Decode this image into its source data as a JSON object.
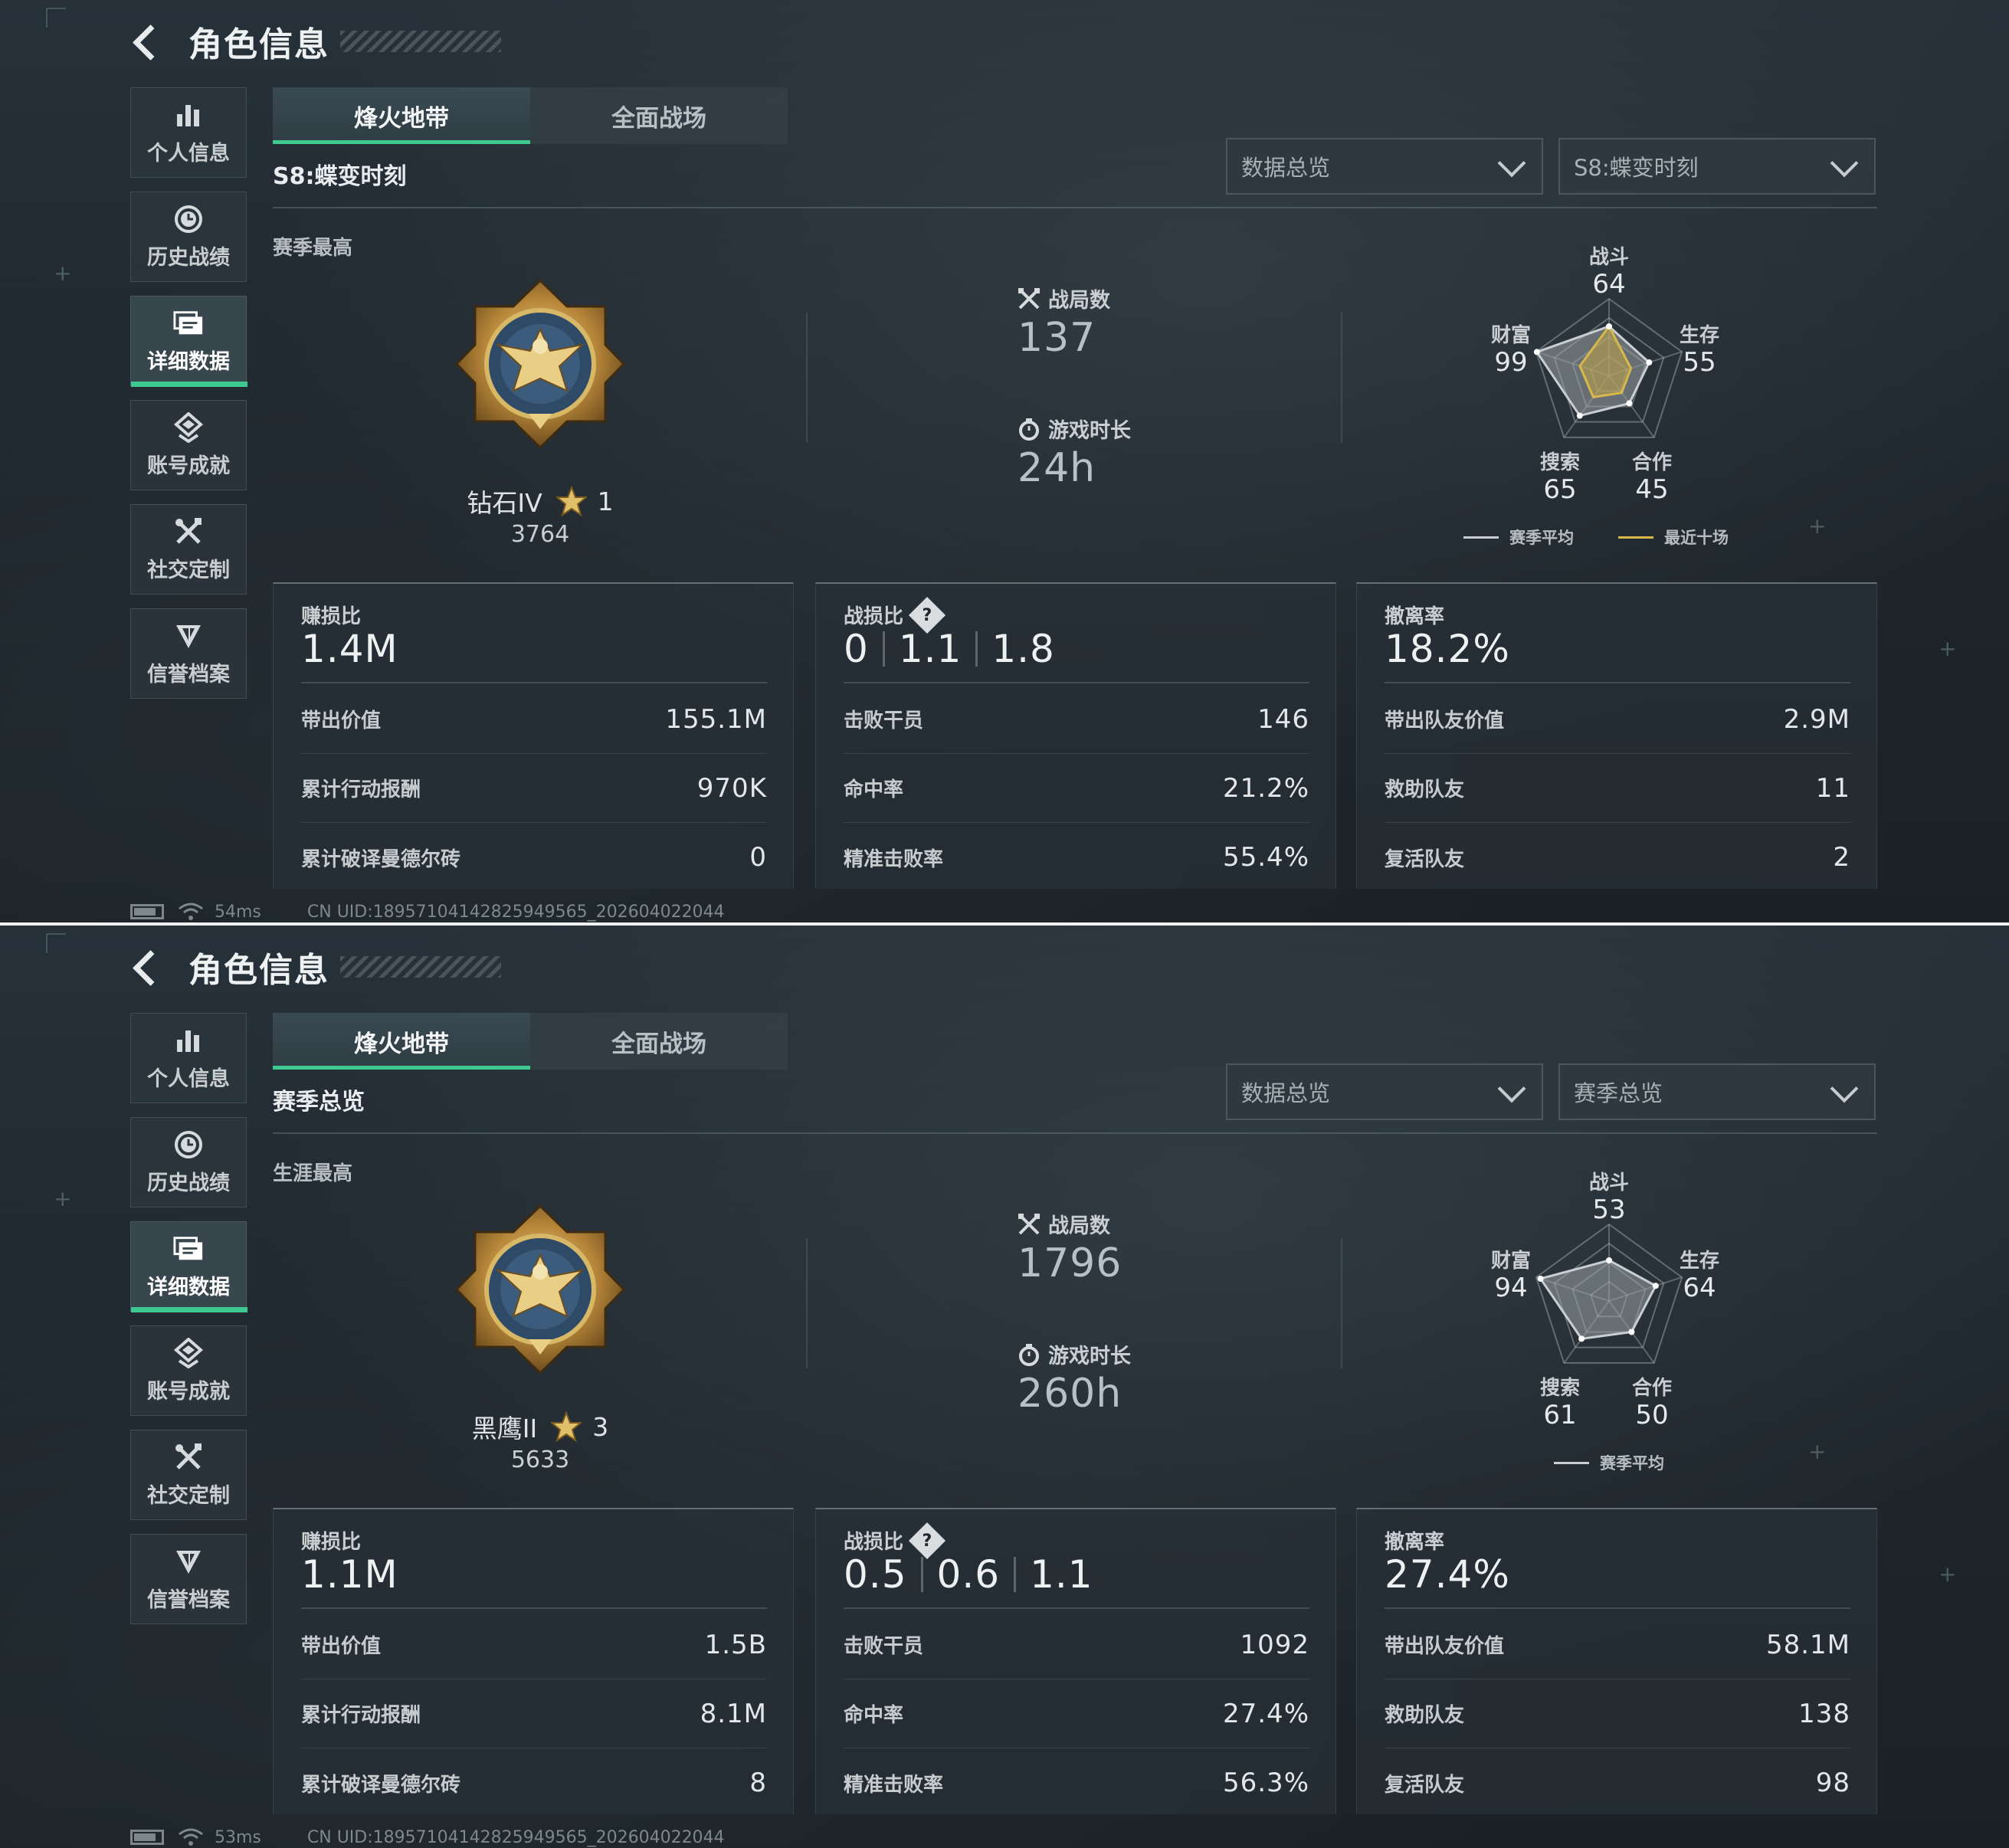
{
  "colors": {
    "accent_green": "#3fc88f",
    "radar_season_avg": "#c9ced1",
    "radar_recent_ten": "#d8b84a",
    "radar_fill_season": "#9aa3a8",
    "radar_fill_recent": "#c9a93f"
  },
  "icons": {
    "back": "chevron-left-icon",
    "personal": "bar-chart-icon",
    "history": "clock-icon",
    "detail": "folder-icon",
    "achievement": "achievement-icon",
    "social": "crossed-tools-icon",
    "credit": "shield-icon",
    "games": "crossed-swords-icon",
    "playtime": "stopwatch-icon",
    "help": "question-icon",
    "star": "star-icon",
    "battery": "battery-icon",
    "wifi": "wifi-icon"
  },
  "panels": [
    {
      "title": "角色信息",
      "sidebar": [
        {
          "label": "个人信息",
          "active": false
        },
        {
          "label": "历史战绩",
          "active": false
        },
        {
          "label": "详细数据",
          "active": true
        },
        {
          "label": "账号成就",
          "active": false
        },
        {
          "label": "社交定制",
          "active": false
        },
        {
          "label": "信誉档案",
          "active": false
        }
      ],
      "tabs": [
        {
          "label": "烽火地带",
          "active": true
        },
        {
          "label": "全面战场",
          "active": false
        }
      ],
      "subtitle": "S8:蝶变时刻",
      "dropdowns": [
        {
          "value": "数据总览"
        },
        {
          "value": "S8:蝶变时刻"
        }
      ],
      "best_label": "赛季最高",
      "rank": {
        "name": "钻石IV",
        "stars": "1",
        "score": "3764"
      },
      "games": {
        "label": "战局数",
        "value": "137"
      },
      "playtime": {
        "label": "游戏时长",
        "value": "24h"
      },
      "radar": {
        "axes": [
          "战斗",
          "生存",
          "合作",
          "搜索",
          "财富"
        ],
        "season_avg": [
          64,
          55,
          45,
          65,
          99
        ],
        "recent_ten": [
          64,
          30,
          28,
          35,
          40
        ],
        "values_text": [
          "64",
          "55",
          "45",
          "65",
          "99"
        ],
        "legend": [
          {
            "label": "赛季平均",
            "color": "#c9ced1"
          },
          {
            "label": "最近十场",
            "color": "#d8b84a"
          }
        ]
      },
      "cards": [
        {
          "head": "赚损比",
          "big": "1.4M",
          "help": false,
          "rows": [
            {
              "label": "带出价值",
              "value": "155.1M"
            },
            {
              "label": "累计行动报酬",
              "value": "970K"
            },
            {
              "label": "累计破译曼德尔砖",
              "value": "0"
            }
          ]
        },
        {
          "head": "战损比",
          "help": true,
          "help_text": "?",
          "ratios": [
            "0",
            "1.1",
            "1.8"
          ],
          "rows": [
            {
              "label": "击败干员",
              "value": "146"
            },
            {
              "label": "命中率",
              "value": "21.2%"
            },
            {
              "label": "精准击败率",
              "value": "55.4%"
            }
          ]
        },
        {
          "head": "撤离率",
          "big": "18.2%",
          "help": false,
          "rows": [
            {
              "label": "带出队友价值",
              "value": "2.9M"
            },
            {
              "label": "救助队友",
              "value": "11"
            },
            {
              "label": "复活队友",
              "value": "2"
            }
          ]
        }
      ],
      "status": {
        "ping": "54ms",
        "uid": "CN UID:18957104142825949565_202604022044"
      }
    },
    {
      "title": "角色信息",
      "sidebar": [
        {
          "label": "个人信息",
          "active": false
        },
        {
          "label": "历史战绩",
          "active": false
        },
        {
          "label": "详细数据",
          "active": true
        },
        {
          "label": "账号成就",
          "active": false
        },
        {
          "label": "社交定制",
          "active": false
        },
        {
          "label": "信誉档案",
          "active": false
        }
      ],
      "tabs": [
        {
          "label": "烽火地带",
          "active": true
        },
        {
          "label": "全面战场",
          "active": false
        }
      ],
      "subtitle": "赛季总览",
      "dropdowns": [
        {
          "value": "数据总览"
        },
        {
          "value": "赛季总览"
        }
      ],
      "best_label": "生涯最高",
      "rank": {
        "name": "黑鹰II",
        "stars": "3",
        "score": "5633"
      },
      "games": {
        "label": "战局数",
        "value": "1796"
      },
      "playtime": {
        "label": "游戏时长",
        "value": "260h"
      },
      "radar": {
        "axes": [
          "战斗",
          "生存",
          "合作",
          "搜索",
          "财富"
        ],
        "season_avg": [
          53,
          64,
          50,
          61,
          94
        ],
        "recent_ten": null,
        "values_text": [
          "53",
          "64",
          "50",
          "61",
          "94"
        ],
        "legend": [
          {
            "label": "赛季平均",
            "color": "#c9ced1"
          }
        ]
      },
      "cards": [
        {
          "head": "赚损比",
          "big": "1.1M",
          "help": false,
          "rows": [
            {
              "label": "带出价值",
              "value": "1.5B"
            },
            {
              "label": "累计行动报酬",
              "value": "8.1M"
            },
            {
              "label": "累计破译曼德尔砖",
              "value": "8"
            }
          ]
        },
        {
          "head": "战损比",
          "help": true,
          "help_text": "?",
          "ratios": [
            "0.5",
            "0.6",
            "1.1"
          ],
          "rows": [
            {
              "label": "击败干员",
              "value": "1092"
            },
            {
              "label": "命中率",
              "value": "27.4%"
            },
            {
              "label": "精准击败率",
              "value": "56.3%"
            }
          ]
        },
        {
          "head": "撤离率",
          "big": "27.4%",
          "help": false,
          "rows": [
            {
              "label": "带出队友价值",
              "value": "58.1M"
            },
            {
              "label": "救助队友",
              "value": "138"
            },
            {
              "label": "复活队友",
              "value": "98"
            }
          ]
        }
      ],
      "status": {
        "ping": "53ms",
        "uid": "CN UID:18957104142825949565_202604022044"
      }
    }
  ]
}
